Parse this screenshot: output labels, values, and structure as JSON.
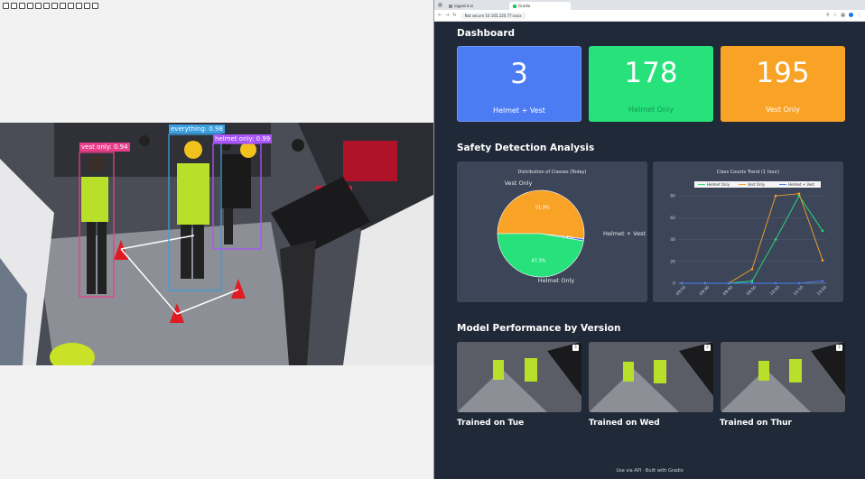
{
  "browser": {
    "tabs": [
      {
        "label": "logpoint.ai"
      },
      {
        "label": "Gradio"
      }
    ],
    "url": "Not secure   10.165.220.77:xxxx"
  },
  "dashboard": {
    "title": "Dashboard",
    "cards": [
      {
        "value": "3",
        "label": "Helmet + Vest",
        "color": "#4b7cf3"
      },
      {
        "value": "178",
        "label": "Helmet Only",
        "color": "#27e27b"
      },
      {
        "value": "195",
        "label": "Vest Only",
        "color": "#f8a226"
      }
    ]
  },
  "analysis": {
    "title": "Safety Detection Analysis"
  },
  "detections": [
    {
      "label": "vest only: 0.94",
      "color": "#e83e8c"
    },
    {
      "label": "everything: 0.98",
      "color": "#3b9ede"
    },
    {
      "label": "helmet only: 0.99",
      "color": "#a855f7"
    }
  ],
  "chart_data": [
    {
      "type": "pie",
      "title": "Distribution of Classes (Today)",
      "categories": [
        "Vest Only",
        "Helmet + Vest",
        "Helmet Only"
      ],
      "values": [
        51.9,
        0.8,
        47.3
      ],
      "labels": [
        "51.9%",
        "0.8%",
        "47.3%"
      ],
      "colors": [
        "#f8a226",
        "#4b7cf3",
        "#27e27b"
      ]
    },
    {
      "type": "line",
      "title": "Class Counts Trend (1 hour)",
      "x": [
        "09:20",
        "09:30",
        "09:40",
        "09:50",
        "10:00",
        "10:10",
        "10:20"
      ],
      "ylim": [
        0,
        90
      ],
      "yticks": [
        0,
        20,
        40,
        60,
        80
      ],
      "series": [
        {
          "name": "Helmet Only",
          "color": "#27e27b",
          "values": [
            0,
            0,
            0,
            2,
            40,
            80,
            48
          ]
        },
        {
          "name": "Vest Only",
          "color": "#f8a226",
          "values": [
            0,
            0,
            0,
            13,
            80,
            82,
            21
          ]
        },
        {
          "name": "Helmet + Vest",
          "color": "#4b7cf3",
          "values": [
            0,
            0,
            0,
            0,
            0,
            0,
            2
          ]
        }
      ]
    }
  ],
  "performance": {
    "title": "Model Performance by Version",
    "versions": [
      {
        "label": "Trained on Tue"
      },
      {
        "label": "Trained on Wed"
      },
      {
        "label": "Trained on Thur"
      }
    ]
  },
  "footer": {
    "text": "Use via API  ·  Built with Gradio"
  }
}
